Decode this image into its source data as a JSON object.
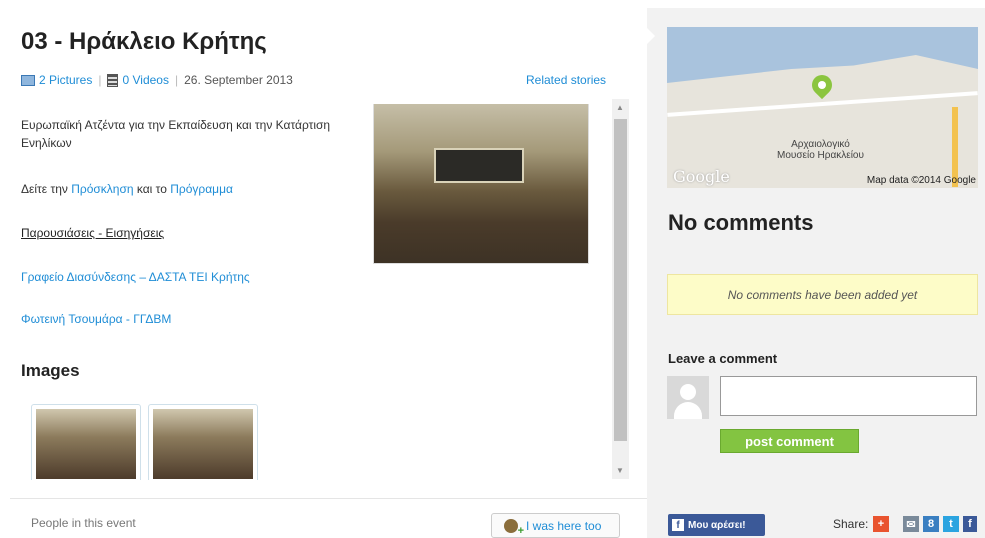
{
  "event": {
    "title": "03 - Ηράκλειο Κρήτης",
    "pictures": "2 Pictures",
    "videos": "0 Videos",
    "date": "26. September 2013",
    "related": "Related stories"
  },
  "content": {
    "paragraph1": "Ευρωπαϊκή Ατζέντα για την Εκπαίδευση και την Κατάρτιση Ενηλίκων",
    "see_prefix": "Δείτε την ",
    "invitation_link": "Πρόσκληση",
    "and_text": " και το ",
    "program_link": "Πρόγραμμα",
    "presentations": "Παρουσιάσεις - Εισηγήσεις",
    "link1": "Γραφείο Διασύνδεσης – ΔΑΣΤΑ ΤΕΙ Κρήτης",
    "link2": "Φωτεινή Τσουμάρα - ΓΓΔΒΜ",
    "images_heading": "Images"
  },
  "footer": {
    "people": "People in this event",
    "was_here": "I was here too"
  },
  "map": {
    "label": "Αρχαιολογικό\nΜουσείο Ηρακλείου",
    "attribution": "Map data ©2014 Google",
    "logo": "Google"
  },
  "comments": {
    "heading": "No comments",
    "notice": "No comments have been added yet",
    "leave": "Leave a comment",
    "post": "post comment"
  },
  "social": {
    "like": "Μου αρέσει!",
    "share": "Share:",
    "icons": [
      "plus-icon",
      "mail-icon",
      "google-plus-icon",
      "twitter-icon",
      "facebook-icon"
    ],
    "colors": {
      "plus": "#e9542f",
      "mail": "#7a8a9a",
      "google": "#3a7fc1",
      "twitter": "#2ba4e0",
      "facebook": "#3b5998"
    }
  }
}
